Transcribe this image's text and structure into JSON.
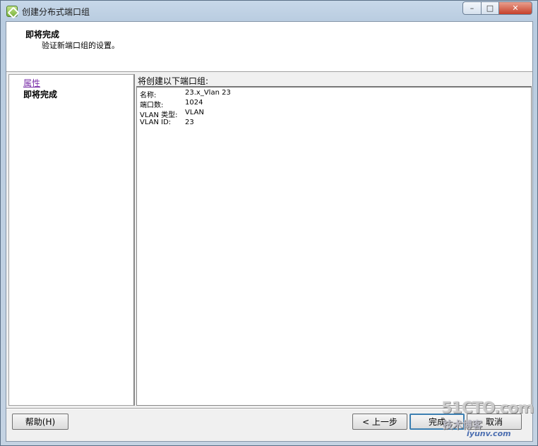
{
  "window": {
    "title": "创建分布式端口组",
    "controls": {
      "minimize": "–",
      "maximize": "□",
      "close": "✕"
    }
  },
  "header": {
    "title": "即将完成",
    "subtitle": "验证新端口组的设置。"
  },
  "nav": {
    "items": [
      {
        "label": "属性",
        "state": "visited-link"
      },
      {
        "label": "即将完成",
        "state": "current"
      }
    ]
  },
  "content": {
    "label": "将创建以下端口组:",
    "properties": [
      {
        "key": "名称:",
        "value": "23.x_Vlan 23"
      },
      {
        "key": "端口数:",
        "value": "1024"
      },
      {
        "key": "VLAN 类型:",
        "value": "VLAN"
      },
      {
        "key": "VLAN ID:",
        "value": "23"
      }
    ]
  },
  "buttons": {
    "help": "帮助(H)",
    "back": "< 上一步",
    "finish": "完成",
    "cancel": "取消"
  },
  "watermark": {
    "line1": "51CTO.com",
    "line2": "技术博客",
    "line3": "iyunv.com"
  }
}
